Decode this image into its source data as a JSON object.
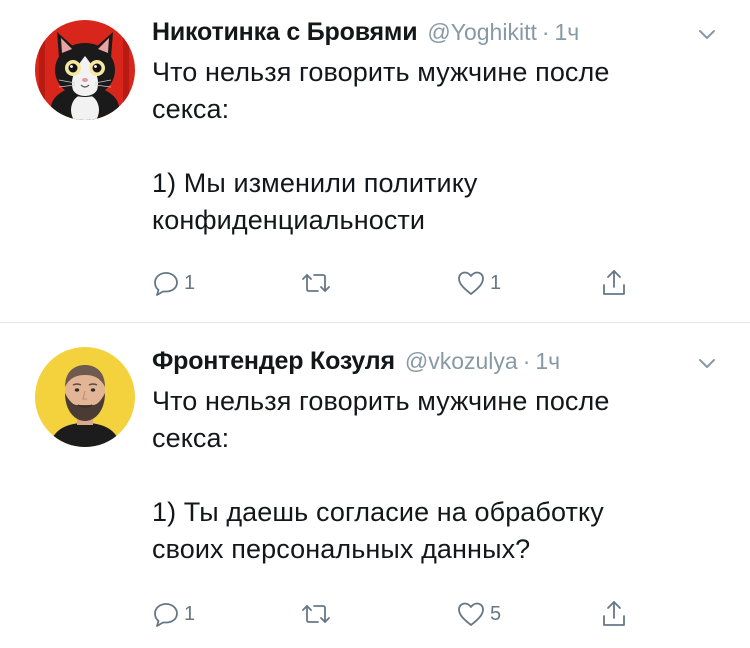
{
  "colors": {
    "accent_gray": "#8899a6",
    "icon_gray": "#657786",
    "text": "#14171a",
    "divider": "#e1e8ed"
  },
  "tweets": [
    {
      "author_name": "Никотинка с Бровями",
      "handle": "@Yoghikitt",
      "separator": "·",
      "time": "1ч",
      "text": "Что нельзя говорить мужчине после\nсекса:\n\n1) Мы изменили политику\nконфиденциальности",
      "reply_count": "1",
      "retweet_count": "",
      "like_count": "1",
      "avatar_icon": "cat-avatar"
    },
    {
      "author_name": "Фронтендер Козуля",
      "handle": "@vkozulya",
      "separator": "·",
      "time": "1ч",
      "text": "Что нельзя говорить мужчине после\nсекса:\n\n1) Ты даешь согласие на обработку\nсвоих персональных данных?",
      "reply_count": "1",
      "retweet_count": "",
      "like_count": "5",
      "avatar_icon": "bearded-man-avatar"
    }
  ],
  "icons": {
    "reply": "reply-icon",
    "retweet": "retweet-icon",
    "like": "heart-icon",
    "share": "share-icon",
    "menu": "chevron-down-icon"
  }
}
